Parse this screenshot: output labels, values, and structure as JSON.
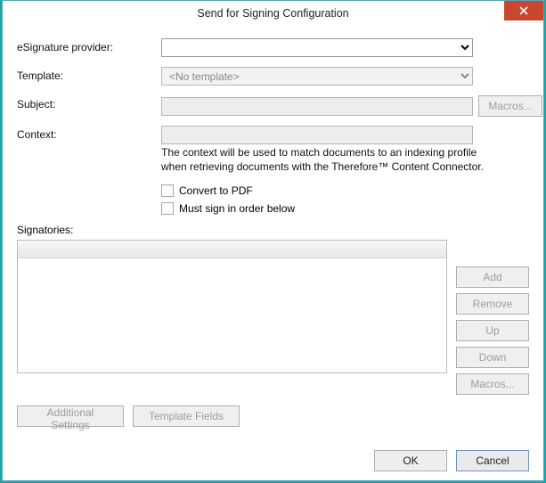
{
  "window": {
    "title": "Send for Signing Configuration"
  },
  "labels": {
    "provider": "eSignature provider:",
    "template": "Template:",
    "subject": "Subject:",
    "context": "Context:",
    "signatories": "Signatories:"
  },
  "fields": {
    "provider_value": "",
    "template_value": "<No template>",
    "subject_value": "",
    "context_value": ""
  },
  "help": {
    "context_text": "The context will be used to match documents to an indexing profile when retrieving documents with the Therefore™ Content Connector."
  },
  "checkboxes": {
    "convert_pdf": "Convert to PDF",
    "must_sign_order": "Must sign in order below"
  },
  "buttons": {
    "macros": "Macros...",
    "add": "Add",
    "remove": "Remove",
    "up": "Up",
    "down": "Down",
    "additional_settings": "Additional Settings",
    "template_fields": "Template Fields",
    "ok": "OK",
    "cancel": "Cancel"
  }
}
